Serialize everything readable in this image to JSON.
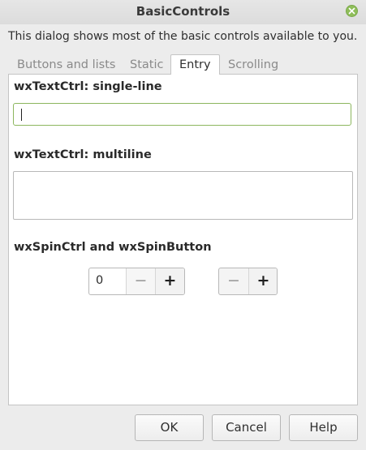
{
  "window": {
    "title": "BasicControls"
  },
  "intro_text": "This dialog shows most of the basic controls available to you.",
  "tabs": [
    {
      "label": "Buttons and lists",
      "active": false
    },
    {
      "label": "Static",
      "active": false
    },
    {
      "label": "Entry",
      "active": true
    },
    {
      "label": "Scrolling",
      "active": false
    }
  ],
  "entry": {
    "single_line_label": "wxTextCtrl: single-line",
    "single_line_value": "",
    "multiline_label": "wxTextCtrl: multiline",
    "multiline_value": "",
    "spin_label": "wxSpinCtrl and wxSpinButton",
    "spin_value": "0",
    "minus_glyph": "−",
    "plus_glyph": "+"
  },
  "buttons": {
    "ok": "OK",
    "cancel": "Cancel",
    "help": "Help"
  },
  "colors": {
    "focus_border": "#8cb65e",
    "close_button": "#8fbe5a"
  },
  "icons": {
    "close": "close-icon"
  }
}
